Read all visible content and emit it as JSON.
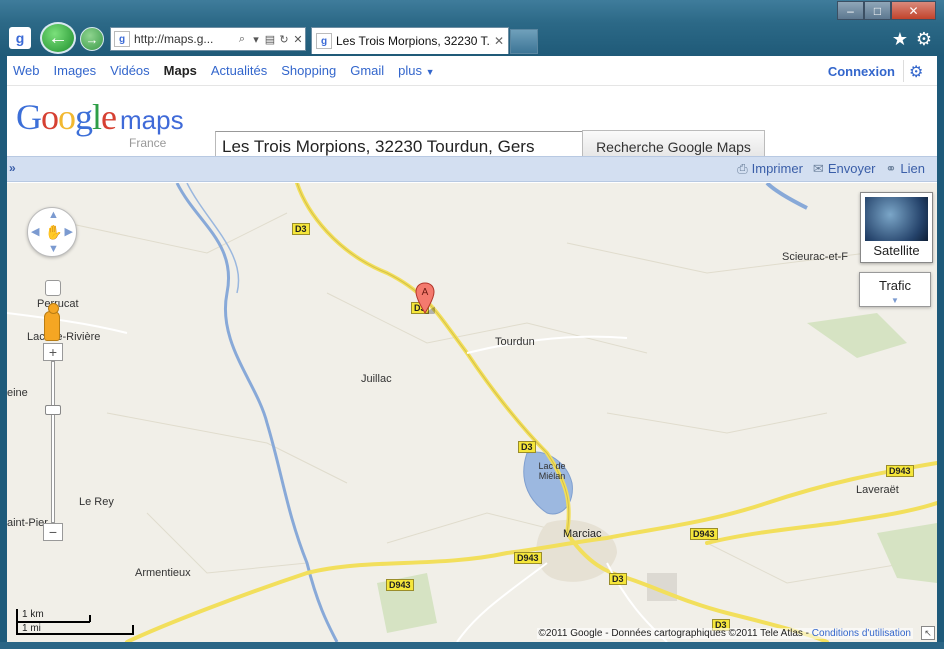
{
  "browser": {
    "address_url": "http://maps.g...",
    "tab_title": "Les Trois Morpions, 32230 T...",
    "window_controls": {
      "minimize": "–",
      "maximize": "□",
      "close": "✕"
    }
  },
  "gbar": {
    "links": [
      "Web",
      "Images",
      "Vidéos",
      "Maps",
      "Actualités",
      "Shopping",
      "Gmail",
      "plus"
    ],
    "active_link": "Maps",
    "signin": "Connexion"
  },
  "header": {
    "logo_google": "Google",
    "logo_maps": "maps",
    "logo_country": "France",
    "search_value": "Les Trois Morpions, 32230 Tourdun, Gers",
    "search_button": "Recherche Google Maps"
  },
  "toolbar": {
    "print": "Imprimer",
    "send": "Envoyer",
    "link": "Lien"
  },
  "map": {
    "places": [
      "Perrucat",
      "Lacave-Rivière",
      "eine",
      "Juillac",
      "Tourdun",
      "Le Rey",
      "aint-Pier",
      "Armentieux",
      "Marciac",
      "Lac de Miélan",
      "Scieurac-et-F",
      "Laveraët"
    ],
    "roads": [
      "D3",
      "D3",
      "D3",
      "D943",
      "D943",
      "D943",
      "D943",
      "D3",
      "D3"
    ],
    "marker_label": "A",
    "satellite_label": "Satellite",
    "traffic_label": "Trafic",
    "scale_km": "1 km",
    "scale_mi": "1 mi",
    "copyright": "©2011 Google - Données cartographiques ©2011 Tele Atlas - ",
    "terms_link": "Conditions d'utilisation"
  }
}
